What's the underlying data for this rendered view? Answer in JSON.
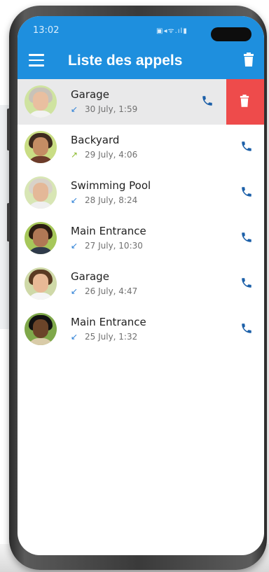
{
  "status_bar": {
    "time": "13:02",
    "icons": "▣◂ᯤ.ıl▮"
  },
  "app_bar": {
    "title": "Liste des appels"
  },
  "colors": {
    "primary": "#1e8fde",
    "delete": "#ee4b4b",
    "incoming": "#2b7fd6",
    "outgoing": "#8dbb2f"
  },
  "calls": [
    {
      "name": "Garage",
      "date": "30 July, 1:59",
      "direction": "incoming",
      "arrow": "↙",
      "swiped": true
    },
    {
      "name": "Backyard",
      "date": "29 July, 4:06",
      "direction": "outgoing",
      "arrow": "↗",
      "swiped": false
    },
    {
      "name": "Swimming Pool",
      "date": "28 July, 8:24",
      "direction": "incoming",
      "arrow": "↙",
      "swiped": false
    },
    {
      "name": "Main Entrance",
      "date": "27 July, 10:30",
      "direction": "incoming",
      "arrow": "↙",
      "swiped": false
    },
    {
      "name": "Garage",
      "date": "26 July, 4:47",
      "direction": "incoming",
      "arrow": "↙",
      "swiped": false
    },
    {
      "name": "Main Entrance",
      "date": "25 July, 1:32",
      "direction": "incoming",
      "arrow": "↙",
      "swiped": false
    }
  ],
  "icons": {
    "menu": "menu-icon",
    "delete": "trash-icon",
    "call": "phone-icon"
  }
}
